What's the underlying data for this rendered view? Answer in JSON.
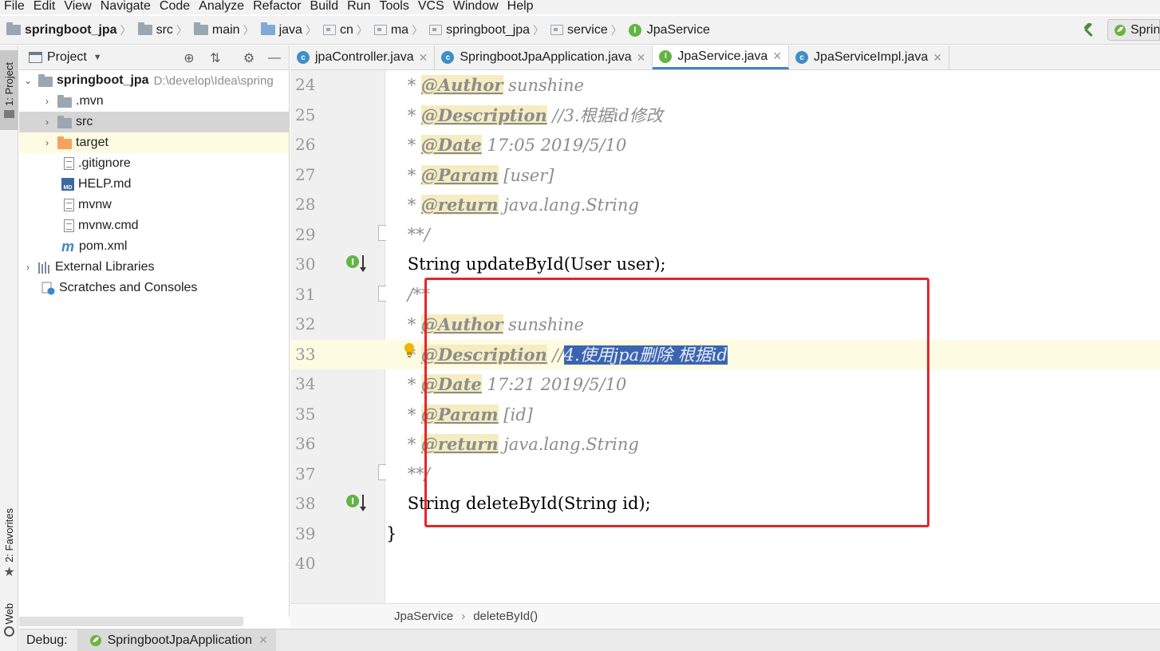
{
  "menubar": {
    "items": [
      "File",
      "Edit",
      "View",
      "Navigate",
      "Code",
      "Analyze",
      "Refactor",
      "Build",
      "Run",
      "Tools",
      "VCS",
      "Window",
      "Help"
    ]
  },
  "navbar": {
    "crumbs": [
      "springboot_jpa",
      "src",
      "main",
      "java",
      "cn",
      "ma",
      "springboot_jpa",
      "service",
      "JpaService"
    ],
    "run_config": "Sprin"
  },
  "left_strip": {
    "project_tab": "1: Project",
    "favorites_tab": "2: Favorites",
    "web_tab": "Web"
  },
  "project_panel": {
    "title": "Project",
    "root": {
      "name": "springboot_jpa",
      "path": "D:\\develop\\Idea\\spring"
    },
    "items": [
      {
        "name": ".mvn",
        "type": "folder"
      },
      {
        "name": "src",
        "type": "folder"
      },
      {
        "name": "target",
        "type": "folder-excluded"
      },
      {
        "name": ".gitignore",
        "type": "file"
      },
      {
        "name": "HELP.md",
        "type": "markdown"
      },
      {
        "name": "mvnw",
        "type": "file"
      },
      {
        "name": "mvnw.cmd",
        "type": "file"
      },
      {
        "name": "pom.xml",
        "type": "maven"
      }
    ],
    "external_libraries": "External Libraries",
    "scratches": "Scratches and Consoles"
  },
  "editor_tabs": [
    {
      "label": "jpaController.java",
      "icon": "class-icon",
      "active": false
    },
    {
      "label": "SpringbootJpaApplication.java",
      "icon": "spring-class-icon",
      "active": false
    },
    {
      "label": "JpaService.java",
      "icon": "interface-icon",
      "active": true
    },
    {
      "label": "JpaServiceImpl.java",
      "icon": "class-icon",
      "active": false
    }
  ],
  "editor": {
    "line_numbers": [
      "24",
      "25",
      "26",
      "27",
      "28",
      "29",
      "30",
      "31",
      "32",
      "33",
      "34",
      "35",
      "36",
      "37",
      "38",
      "39",
      "40"
    ],
    "current_line": "33",
    "lines": {
      "l24": {
        "prefix": " * ",
        "tag": "@Author",
        "rest": " sunshine"
      },
      "l25": {
        "prefix": " * ",
        "tag": "@Description",
        "rest": " //3.根据id修改"
      },
      "l26": {
        "prefix": " * ",
        "tag": "@Date",
        "rest": " 17:05 2019/5/10"
      },
      "l27": {
        "prefix": " * ",
        "tag": "@Param",
        "rest": " [user]"
      },
      "l28": {
        "prefix": " * ",
        "tag": "@return",
        "rest": " java.lang.String"
      },
      "l29": {
        "text": " **/"
      },
      "l30": {
        "text": "String updateById(User user);"
      },
      "l31": {
        "text": "/**"
      },
      "l32": {
        "prefix": " * ",
        "tag": "@Author",
        "rest": " sunshine"
      },
      "l33": {
        "prefix": " * ",
        "tag": "@Description",
        "rest": " //",
        "selected": "4.使用jpa删除 根据id"
      },
      "l34": {
        "prefix": " * ",
        "tag": "@Date",
        "rest": " 17:21 2019/5/10"
      },
      "l35": {
        "prefix": " * ",
        "tag": "@Param",
        "rest": " [id]"
      },
      "l36": {
        "prefix": " * ",
        "tag": "@return",
        "rest": " java.lang.String"
      },
      "l37": {
        "text": " **/"
      },
      "l38": {
        "text": "String deleteById(String id);"
      },
      "l39": {
        "text": "}"
      },
      "l40": {
        "text": ""
      }
    },
    "highlight_color": "#e8232a"
  },
  "editor_breadcrumbs": [
    "JpaService",
    "deleteById()"
  ],
  "debug_bar": {
    "label": "Debug:",
    "tab": "SpringbootJpaApplication"
  }
}
